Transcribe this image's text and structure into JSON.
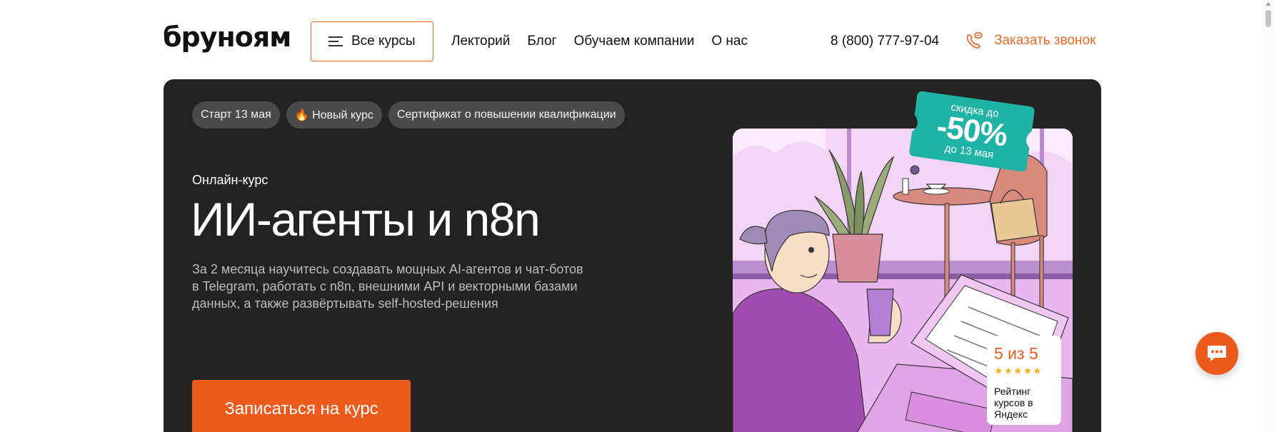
{
  "header": {
    "logo": "бруноям",
    "all_courses": "Все курсы",
    "nav": [
      "Лекторий",
      "Блог",
      "Обучаем компании",
      "О нас"
    ],
    "phone": "8 (800) 777-97-04",
    "callback": "Заказать звонок"
  },
  "hero": {
    "tags": [
      "Старт 13 мая",
      "🔥 Новый курс",
      "Сертификат о повышении квалификации"
    ],
    "eyebrow": "Онлайн-курс",
    "title": "ИИ-агенты и n8n",
    "description": "За 2 месяца научитесь создавать мощных AI-агентов и чат-ботов в Telegram, работать с n8n, внешними API и векторными базами данных, а также развёртывать self-hosted-решения",
    "cta": "Записаться на курс"
  },
  "discount": {
    "line1": "скидка до",
    "value": "-50%",
    "line2": "до 13 мая"
  },
  "rating": {
    "score": "5 из 5",
    "stars": 5,
    "label": "Рейтинг курсов в Яндекс"
  },
  "icons": {
    "menu": "burger-icon",
    "callback": "phone-icon",
    "chat": "chat-icon"
  },
  "colors": {
    "accent": "#ec5a1c",
    "hero_bg": "#232323",
    "discount_bg": "#1fb3a6",
    "star": "#f5b325"
  }
}
